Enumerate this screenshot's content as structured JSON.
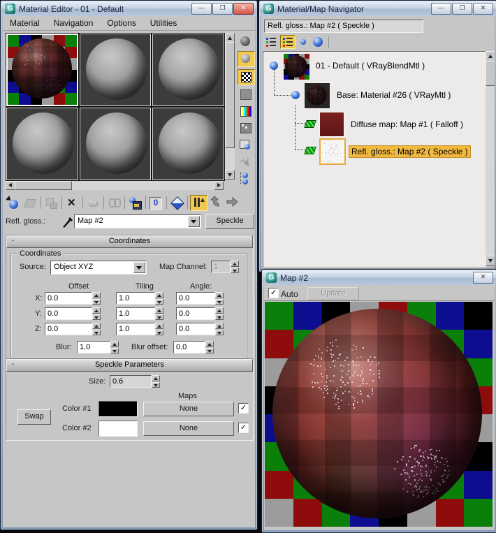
{
  "chrome": {
    "minimize_glyph": "—",
    "maximize_glyph": "❐",
    "close_glyph": "✕",
    "check_glyph": "✓",
    "scroll_up": "▲",
    "scroll_down": "▼",
    "scroll_left": "◄",
    "scroll_right": "►",
    "collapse_glyph": "-"
  },
  "colors": {
    "titlebar_top": "#e9f0f8",
    "titlebar_bottom": "#a9bbd2",
    "ui_gray": "#c6c6c6",
    "active_button_highlight": "#f2c94f",
    "tree_selection": "#f2b941",
    "checker_palette": [
      "#0a7f0a",
      "#0d0d8f",
      "#000000",
      "#9c9c9c",
      "#8f0c0c"
    ],
    "sphere_red": "#7a2626",
    "color1_hex": "#000000",
    "color2_hex": "#ffffff"
  },
  "material_editor": {
    "title": "Material Editor - 01 - Default",
    "menus": [
      "Material",
      "Navigation",
      "Options",
      "Utilities"
    ],
    "sample_slots": {
      "rows": 2,
      "cols": 3,
      "active_index": 0
    },
    "vertical_toolbar_icons": [
      "sample-type-sphere",
      "backlight",
      "background-checker",
      "sample-uv-tiling",
      "video-color-check",
      "make-preview",
      "options",
      "select-by-material",
      "material-map-navigator"
    ],
    "main_toolbar_icons": [
      "get-material",
      "put-material-to-scene",
      "assign-material-to-selection",
      "reset-map",
      "make-material-copy",
      "make-unique",
      "put-to-library",
      "material-id-channel",
      "show-map-in-viewport",
      "show-end-result",
      "go-to-parent",
      "go-forward-to-sibling"
    ],
    "map_row": {
      "label": "Refl. gloss.:",
      "picker_icon": "pick-material-eyedropper",
      "value": "Map #2",
      "type_button": "Speckle"
    },
    "coordinates": {
      "rollout_title": "Coordinates",
      "group_title": "Coordinates",
      "source_label": "Source:",
      "source_value": "Object XYZ",
      "map_channel_label": "Map Channel:",
      "map_channel_value": "1",
      "col_headers": [
        "Offset",
        "Tiling",
        "Angle:"
      ],
      "rows": [
        {
          "axis": "X:",
          "offset": "0.0",
          "tiling": "1.0",
          "angle": "0.0"
        },
        {
          "axis": "Y:",
          "offset": "0.0",
          "tiling": "1.0",
          "angle": "0.0"
        },
        {
          "axis": "Z:",
          "offset": "0.0",
          "tiling": "1.0",
          "angle": "0.0"
        }
      ],
      "blur_label": "Blur:",
      "blur_value": "1.0",
      "blur_offset_label": "Blur offset:",
      "blur_offset_value": "0.0"
    },
    "speckle": {
      "rollout_title": "Speckle Parameters",
      "size_label": "Size:",
      "size_value": "0.6",
      "maps_header": "Maps",
      "swap_label": "Swap",
      "color1_label": "Color #1",
      "color1_map": "None",
      "color1_enabled": true,
      "color2_label": "Color #2",
      "color2_map": "None",
      "color2_enabled": true
    }
  },
  "navigator": {
    "title": "Material/Map Navigator",
    "path_field": "Refl. gloss.: Map #2  ( Speckle )",
    "toolbar_icons": [
      "view-list",
      "view-list-with-icons",
      "view-small-icons",
      "view-large-icons"
    ],
    "tree": [
      {
        "label": "01 - Default  ( VRayBlendMtl )",
        "type": "material",
        "selected": false
      },
      {
        "label": "Base: Material #26  ( VRayMtl )",
        "type": "material",
        "selected": false
      },
      {
        "label": "Diffuse map: Map #1  ( Falloff )",
        "type": "map",
        "selected": false
      },
      {
        "label": "Refl. gloss.: Map #2  ( Speckle )",
        "type": "map",
        "selected": true
      }
    ]
  },
  "map_window": {
    "title": "Map #2",
    "auto_label": "Auto",
    "auto_checked": true,
    "update_label": "Update",
    "update_enabled": false
  }
}
